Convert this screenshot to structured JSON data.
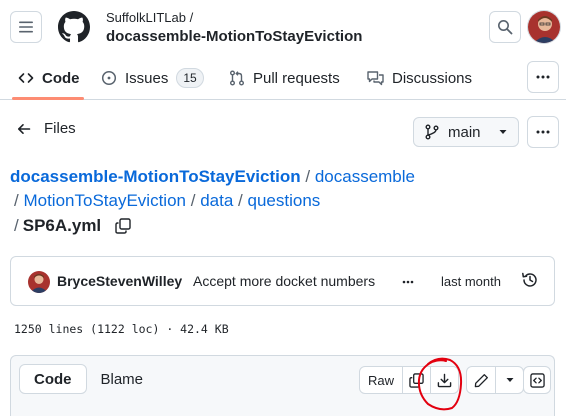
{
  "header": {
    "owner": "SuffolkLITLab /",
    "repo": "docassemble-MotionToStayEviction"
  },
  "nav": {
    "tabs": [
      {
        "label": "Code",
        "icon": "code-icon",
        "active": true
      },
      {
        "label": "Issues",
        "icon": "issue-opened-icon",
        "count": "15"
      },
      {
        "label": "Pull requests",
        "icon": "git-pull-request-icon"
      },
      {
        "label": "Discussions",
        "icon": "comment-discussion-icon"
      }
    ]
  },
  "files": {
    "back_label": "Files",
    "branch": "main"
  },
  "breadcrumb": {
    "repo": "docassemble-MotionToStayEviction",
    "sep": "/",
    "segments": [
      "docassemble",
      "MotionToStayEviction",
      "data",
      "questions"
    ],
    "filename": "SP6A.yml"
  },
  "commit": {
    "author": "BryceStevenWilley",
    "message": "Accept more docket numbers",
    "time": "last month"
  },
  "file_meta": "1250 lines (1122 loc) · 42.4 KB",
  "toolbar": {
    "code_label": "Code",
    "blame_label": "Blame",
    "raw_label": "Raw"
  },
  "colors": {
    "link": "#0969da",
    "tab_underline": "#fd8c73",
    "annotation": "#e3000f"
  }
}
